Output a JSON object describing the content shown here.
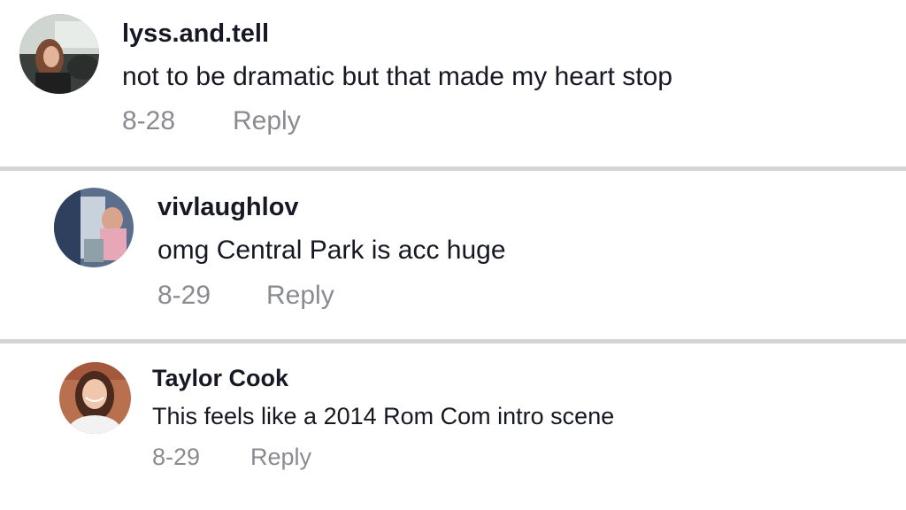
{
  "comments": [
    {
      "username": "lyss.and.tell",
      "text": "not to be dramatic but that made my heart stop",
      "date": "8-28",
      "reply_label": "Reply",
      "avatar_icon": "user-avatar-photo"
    },
    {
      "username": "vivlaughlov",
      "text": "omg Central Park is acc huge",
      "date": "8-29",
      "reply_label": "Reply",
      "avatar_icon": "user-avatar-photo"
    },
    {
      "username": "Taylor Cook",
      "text": "This feels like a 2014 Rom Com intro scene",
      "date": "8-29",
      "reply_label": "Reply",
      "avatar_icon": "user-avatar-photo"
    }
  ],
  "colors": {
    "text_primary": "#161823",
    "text_secondary": "#8a8b91",
    "divider": "#d4d4d6",
    "background": "#ffffff"
  }
}
